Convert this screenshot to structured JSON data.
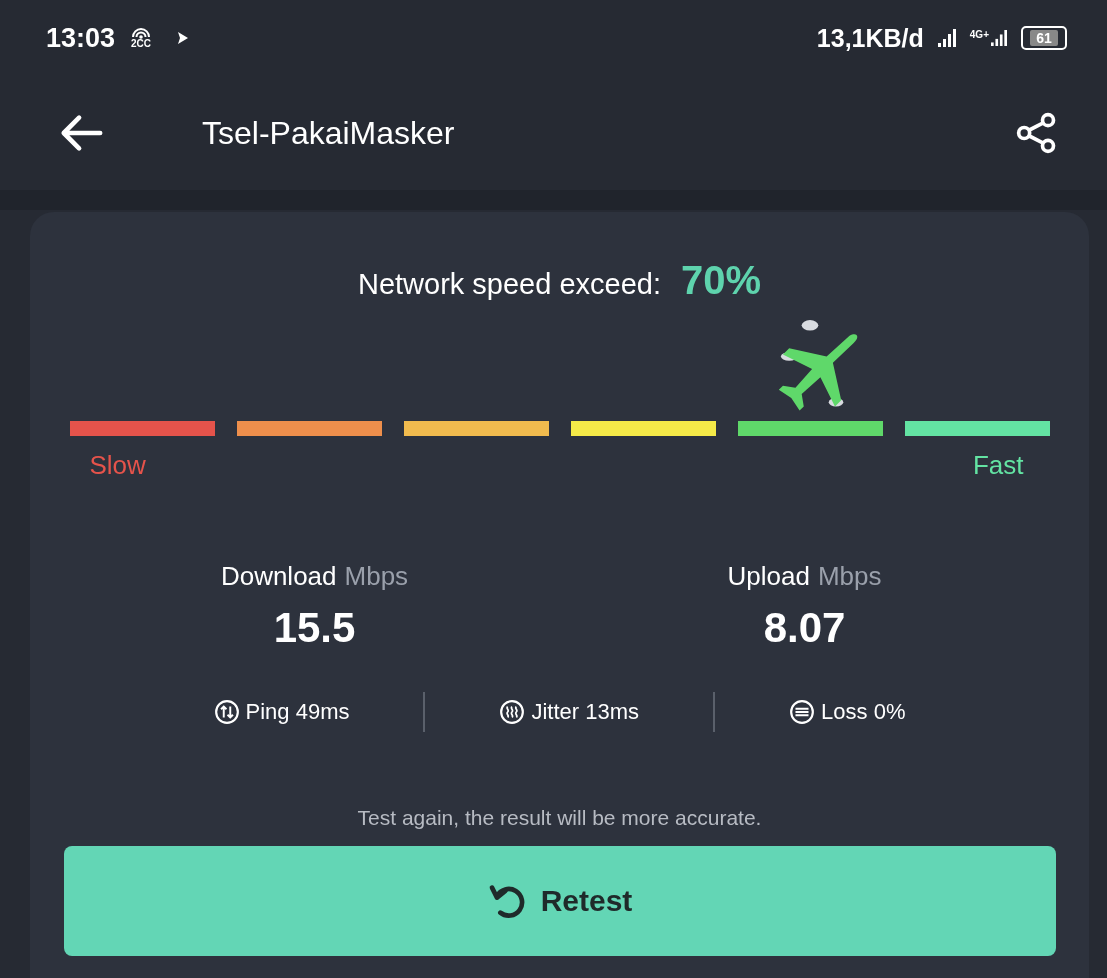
{
  "status_bar": {
    "time": "13:03",
    "hotspot_label": "2CC",
    "data_rate": "13,1KB/d",
    "network_label": "4G+",
    "battery": "61"
  },
  "app_bar": {
    "title": "Tsel-PakaiMasker"
  },
  "result": {
    "heading": "Network speed exceed:",
    "percent": "70%",
    "segments": [
      {
        "color": "#e5534b",
        "selected": false
      },
      {
        "color": "#ee8f4c",
        "selected": false
      },
      {
        "color": "#f1bb4e",
        "selected": false
      },
      {
        "color": "#f5ea48",
        "selected": false
      },
      {
        "color": "#5fd86a",
        "selected": true
      },
      {
        "color": "#63e3a3",
        "selected": false
      }
    ],
    "slow_label": "Slow",
    "fast_label": "Fast",
    "speeds": [
      {
        "label": "Download",
        "unit": "Mbps",
        "value": "15.5"
      },
      {
        "label": "Upload",
        "unit": "Mbps",
        "value": "8.07"
      }
    ],
    "metrics": [
      {
        "kind": "ping",
        "text": "Ping 49ms"
      },
      {
        "kind": "jitter",
        "text": "Jitter 13ms"
      },
      {
        "kind": "loss",
        "text": "Loss 0%"
      }
    ],
    "hint": "Test again, the result will be more accurate.",
    "retest_button": "Retest"
  }
}
